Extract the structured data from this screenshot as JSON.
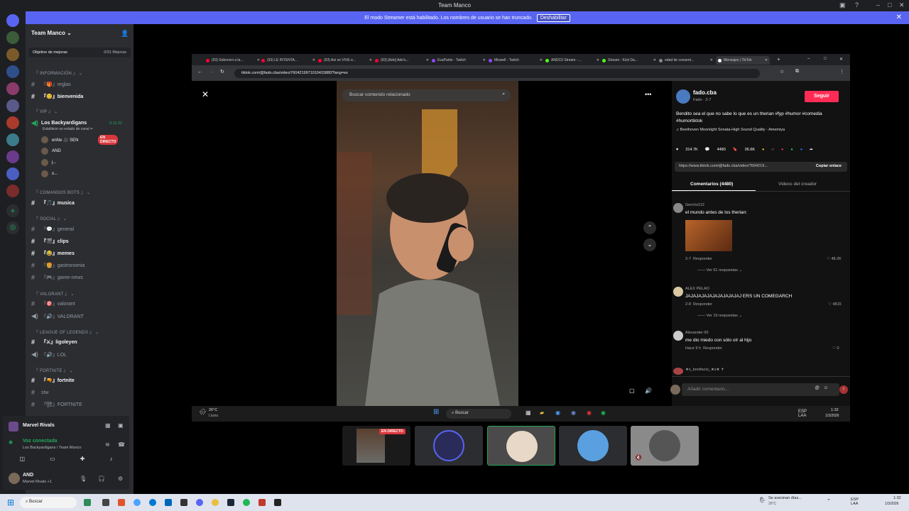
{
  "window": {
    "title": "Team Manco"
  },
  "banner": {
    "text": "El modo Streamer está habilitado. Los nombres de usuario se han truncado.",
    "button": "Deshabilitar"
  },
  "sidebar": {
    "server_name": "Team Manco",
    "goal": {
      "label": "Objetivo de mejoras",
      "progress": "0/31 Mejoras"
    },
    "items": [
      {
        "type": "cat",
        "label": "『 INFORMACIÓN 』"
      },
      {
        "type": "ch",
        "label": "『🎁』reglas"
      },
      {
        "type": "ch",
        "label": "『😊』bienvenida",
        "bold": true
      },
      {
        "type": "cat",
        "label": "『 VIP 』"
      },
      {
        "type": "voice",
        "label": "Los Backyardigans",
        "time": "9:11:22"
      },
      {
        "type": "status",
        "label": "Establece un estado de canal ✏"
      },
      {
        "type": "user",
        "label": "enNe 🎥 SEN",
        "badge": "EN DIRECTO"
      },
      {
        "type": "user",
        "label": "AND"
      },
      {
        "type": "user",
        "label": "j..."
      },
      {
        "type": "user",
        "label": "x..."
      },
      {
        "type": "cat",
        "label": "『 COMANDOS BOTS 』"
      },
      {
        "type": "ch",
        "label": "『🎵』musica",
        "bold": true
      },
      {
        "type": "cat",
        "label": "『 SOCIAL 』"
      },
      {
        "type": "ch",
        "label": "『💬』general"
      },
      {
        "type": "ch",
        "label": "『🎬』clips",
        "bold": true
      },
      {
        "type": "ch",
        "label": "『😂』memes",
        "bold": true
      },
      {
        "type": "ch",
        "label": "『🍔』gastronomia"
      },
      {
        "type": "ch",
        "label": "『🎮』game-news"
      },
      {
        "type": "cat",
        "label": "『 VALORANT 』"
      },
      {
        "type": "ch",
        "label": "『🎯』valorant"
      },
      {
        "type": "vc",
        "label": "『🔊』VALORANT"
      },
      {
        "type": "cat",
        "label": "『 LEAGUE OF LEGENDS 』"
      },
      {
        "type": "ch",
        "label": "『⚔』ligoleyen",
        "bold": true
      },
      {
        "type": "vc",
        "label": "『🔊』LOL"
      },
      {
        "type": "cat",
        "label": "『 FORTNITE 』"
      },
      {
        "type": "ch",
        "label": "『🔫』fortnite",
        "bold": true
      },
      {
        "type": "ch",
        "label": "stw"
      },
      {
        "type": "ch",
        "label": "『🏗』FORTNITE"
      }
    ]
  },
  "panel": {
    "activity": "Marvel Rivals",
    "voice_status": "Voz conectada",
    "voice_channel": "Los Backyardigans / Team Manco",
    "user_name": "AND",
    "user_status": "Marvel Rivals +1"
  },
  "browser": {
    "tabs": [
      "(93) Sobrevivi a la...",
      "(93) LE INTENTA...",
      "(93) Así se VIVE e...",
      "(93) [Ado] Ado's...",
      "EvaPartis - Twitch",
      "Miswell - Twitch",
      "ANDC0 Stream - ...",
      "Stream - Kick Da...",
      "edad de consent...",
      "Mensajes | TikTok"
    ],
    "url": "tiktok.com/@fado.cba/video/7604219971010415880?lang=es",
    "search_placeholder": "Buscar contenido relacionado",
    "profile": {
      "name": "fado.cba",
      "handle": "Fado · 2-7",
      "follow": "Seguir",
      "caption": "Bendito sea el que no sabe lo que es un therian #fyp #humor #comedia #humortiktok",
      "music": "♫ Beethoven Moonlight Sonata-High Sound Quality - Amemiya",
      "likes": "314.7K",
      "comments": "4480",
      "saves": "36.6K",
      "link": "https://www.tiktok.com/@fado.cba/video/7604219...",
      "copy": "Copiar enlace"
    },
    "tab_comments": "Comentarios (4480)",
    "tab_videos": "Videos del creador",
    "comments": [
      {
        "user": "Gercho112",
        "text": "el mundo antes de los therian:",
        "meta": "2-7",
        "reply": "Responder",
        "likes": "48.2K",
        "more": "Ver 61 respuestas"
      },
      {
        "user": "ALEX PELAO",
        "text": "JAJAJAJAJAJAJAJAJAJAJ ERS UN COMEGARCH",
        "meta": "2-8",
        "reply": "Responder",
        "likes": "4815",
        "more": "Ver 19 respuestas"
      },
      {
        "user": "Alexander 00",
        "text": "me dio miedo con sólo oír al hijo",
        "meta": "Hace 9 h",
        "reply": "Responder",
        "likes": "0"
      },
      {
        "user": "★s_bonifacio_★s★ ✝",
        "text": ""
      }
    ],
    "add_comment": "Añadir comentario...",
    "weather": {
      "temp": "26°C",
      "desc": "Lluvia"
    },
    "taskbar_search": "Buscar",
    "lang": "ESP\nLAA",
    "time": "1:32",
    "date": "1/3/2026"
  },
  "tiles": {
    "live_badge": "EN DIRECTO"
  },
  "taskbar": {
    "search": "Buscar",
    "weather": "Se avecinan días...",
    "weather_sub": "26°C",
    "lang": "ESP\nLAA",
    "time": "1:32",
    "date": "1/3/2026"
  }
}
